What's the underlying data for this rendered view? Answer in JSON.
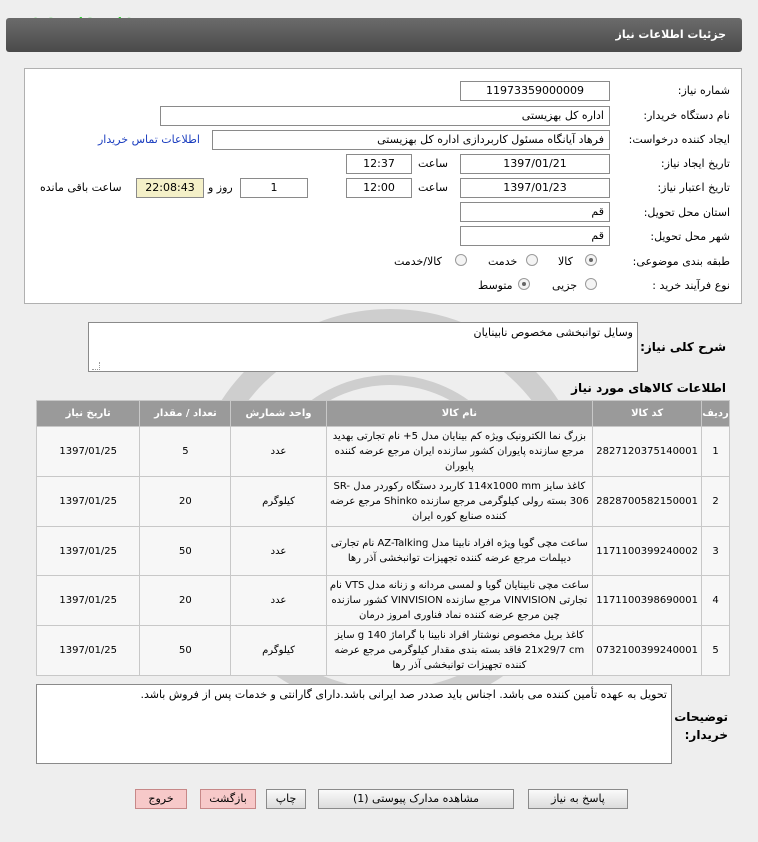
{
  "stamp_date": "1397/01/21",
  "header": {
    "title": "جزئیات اطلاعات نیاز"
  },
  "form": {
    "need_number_label": "شماره نیاز:",
    "need_number": "11973359000009",
    "buyer_label": "نام دستگاه خریدار:",
    "buyer": "اداره کل بهزیستی",
    "requester_label": "ایجاد کننده درخواست:",
    "requester": "فرهاد آیانگاه مسئول کاربردازی اداره کل بهزیستی",
    "contact_link": "اطلاعات تماس خریدار",
    "created_label": "تاریخ ایجاد نیاز:",
    "created_date": "1397/01/21",
    "time_label": "ساعت",
    "created_time": "12:37",
    "validity_label": "تاریخ اعتبار نیاز:",
    "validity_date": "1397/01/23",
    "validity_time": "12:00",
    "days_left": "1",
    "day_and_label": "روز و",
    "time_left": "22:08:43",
    "time_left_label": "ساعت باقی مانده",
    "province_label": "استان محل تحویل:",
    "province": "قم",
    "city_label": "شهر محل تحویل:",
    "city": "قم",
    "category_label": "طبقه بندی موضوعی:",
    "category_options": [
      "کالا",
      "خدمت",
      "کالا/خدمت"
    ],
    "category_selected": "کالا",
    "process_label": "نوع فرآیند خرید :",
    "process_options": [
      "جزیی",
      "متوسط"
    ],
    "process_selected": "متوسط"
  },
  "description": {
    "label": "شرح کلی نیاز:",
    "text": "وسایل توانبخشی مخصوص نابینایان"
  },
  "goods": {
    "title": "اطلاعات کالاهای مورد نیاز",
    "columns": [
      "ردیف",
      "کد کالا",
      "نام کالا",
      "واحد شمارش",
      "تعداد / مقدار",
      "تاریخ نیاز"
    ],
    "rows": [
      {
        "row": "1",
        "code": "2827120375140001",
        "name": "بزرگ نما الکترونیک ویژه کم بینایان مدل 5+ نام تجارتی بهدید مرجع سازنده پایوران کشور سازنده ایران مرجع عرضه کننده پایوران",
        "unit": "عدد",
        "qty": "5",
        "date": "1397/01/25"
      },
      {
        "row": "2",
        "code": "2828700582150001",
        "name": "کاغذ سایز 114x1000 mm کاربرد دستگاه رکوردر مدل SR-306 بسته رولی کیلوگرمی مرجع سازنده Shinko مرجع عرضه کننده صنایع کوره ایران",
        "unit": "کیلوگرم",
        "qty": "20",
        "date": "1397/01/25"
      },
      {
        "row": "3",
        "code": "1171100399240002",
        "name": "ساعت مچی گویا ویژه افراد نابینا مدل AZ-Talking نام تجارتی دیپلمات مرجع عرضه کننده تجهیزات توانبخشی آذر رها",
        "unit": "عدد",
        "qty": "50",
        "date": "1397/01/25"
      },
      {
        "row": "4",
        "code": "1171100398690001",
        "name": "ساعت مچی نابینایان گویا و لمسی مردانه و زنانه مدل VTS نام تجارتی VINVISION مرجع سازنده VINVISION کشور سازنده چین مرجع عرضه کننده نماد فناوری امروز درمان",
        "unit": "عدد",
        "qty": "20",
        "date": "1397/01/25"
      },
      {
        "row": "5",
        "code": "0732100399240001",
        "name": "کاغذ بریل مخصوص نوشتار افراد نابینا با گراماژ 140 g سایز 21x29/7 cm فاقد بسته بندی مقدار کیلوگرمی مرجع عرضه کننده تجهیزات توانبخشی آذر رها",
        "unit": "کیلوگرم",
        "qty": "50",
        "date": "1397/01/25"
      }
    ]
  },
  "notes": {
    "label": "توضیحات خریدار:",
    "text": "تحویل به عهده تأمین کننده می باشد. اجناس باید صددر صد ایرانی باشد.دارای گارانتی و خدمات پس از فروش  باشد."
  },
  "buttons": {
    "reply": "پاسخ به نیاز",
    "attachments": "مشاهده مدارک پیوستی (1)",
    "print": "چاپ",
    "back": "بازگشت",
    "exit": "خروج"
  }
}
